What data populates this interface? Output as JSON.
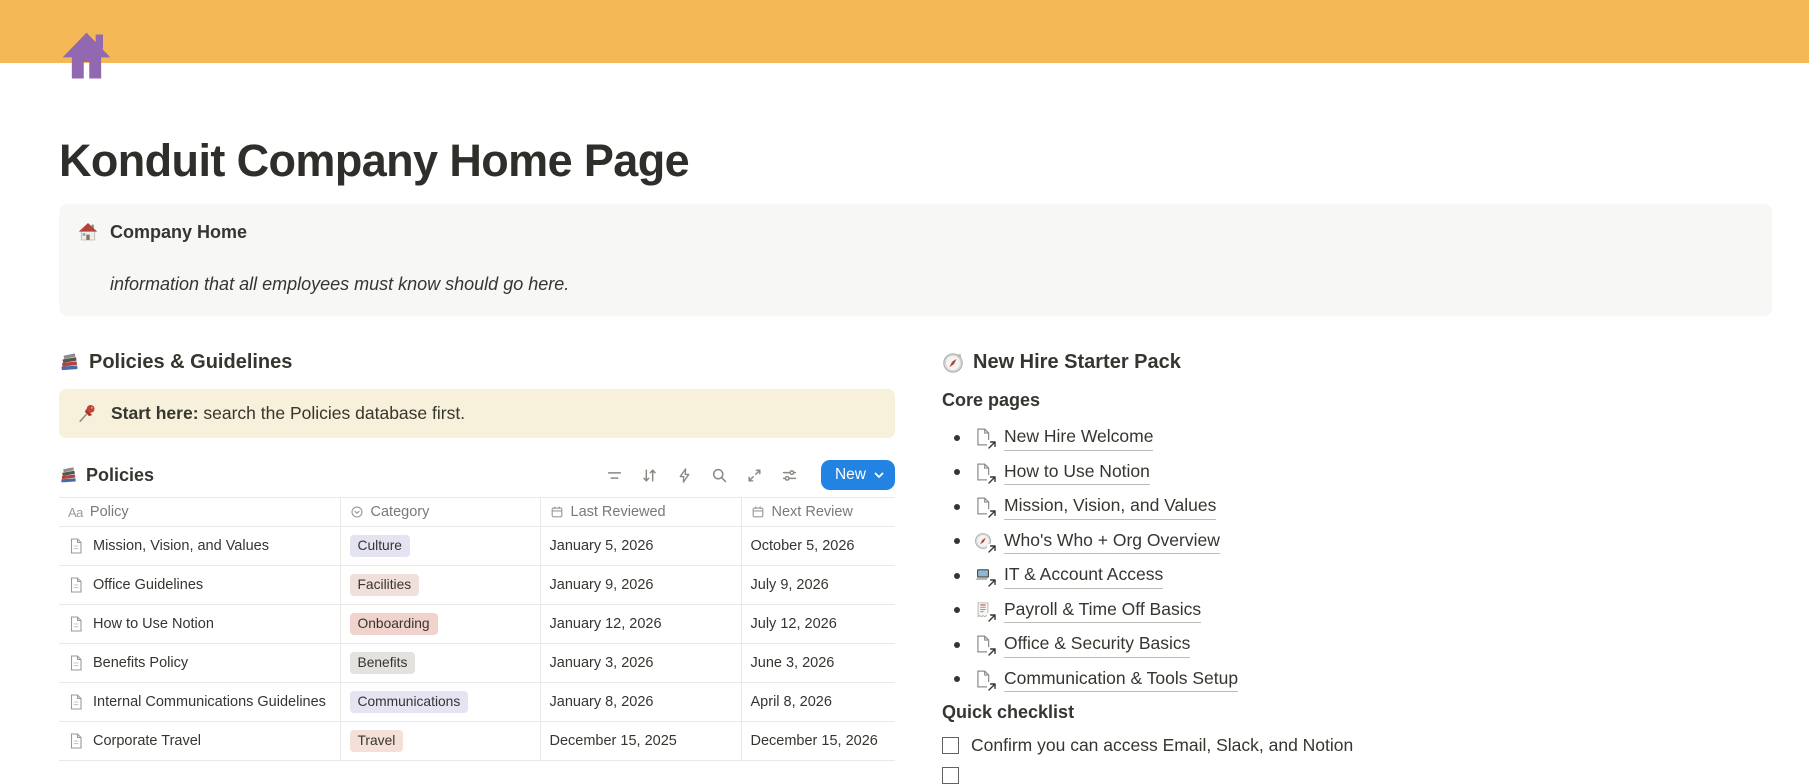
{
  "page": {
    "title": "Konduit Company Home Page"
  },
  "colors": {
    "cover": "#F5B857",
    "page_icon_purple": "#9268B1",
    "accent_blue": "#2383E2",
    "gray_callout_bg": "#F7F7F5",
    "yellow_callout_bg": "#F7F0DB"
  },
  "callout": {
    "icon": "house-icon",
    "title": "Company Home",
    "note": "information that all employees must know should go here."
  },
  "left": {
    "heading": "Policies & Guidelines",
    "heading_icon": "books-icon",
    "tip_icon": "pushpin-icon",
    "tip_bold": "Start here:",
    "tip_rest": " search the Policies database first.",
    "database": {
      "icon": "books-icon",
      "title": "Policies",
      "toolbar_icons": [
        "filter-icon",
        "sort-icon",
        "automation-icon",
        "search-icon",
        "expand-icon",
        "view-options-icon"
      ],
      "new_button": "New",
      "columns": [
        {
          "label": "Policy",
          "icon": "text-property-icon"
        },
        {
          "label": "Category",
          "icon": "select-property-icon"
        },
        {
          "label": "Last Reviewed",
          "icon": "date-property-icon"
        },
        {
          "label": "Next Review",
          "icon": "date-property-icon"
        }
      ],
      "rows": [
        {
          "policy": "Mission, Vision, and Values",
          "category": "Culture",
          "badge_style": "background:#E4E3F1",
          "last_reviewed": "January 5, 2026",
          "next_review": "October 5, 2026"
        },
        {
          "policy": "Office Guidelines",
          "category": "Facilities",
          "badge_style": "background:#F1DFDB",
          "last_reviewed": "January 9, 2026",
          "next_review": "July 9, 2026"
        },
        {
          "policy": "How to Use Notion",
          "category": "Onboarding",
          "badge_style": "background:#EFD3CC",
          "last_reviewed": "January 12, 2026",
          "next_review": "July 12, 2026"
        },
        {
          "policy": "Benefits Policy",
          "category": "Benefits",
          "badge_style": "background:#E3E2DE",
          "last_reviewed": "January 3, 2026",
          "next_review": "June 3, 2026"
        },
        {
          "policy": "Internal Communications Guidelines",
          "category": "Communications",
          "badge_style": "background:#E6E3F3",
          "last_reviewed": "January 8, 2026",
          "next_review": "April 8, 2026"
        },
        {
          "policy": "Corporate Travel",
          "category": "Travel",
          "badge_style": "background:#F5E0D7",
          "last_reviewed": "December 15, 2025",
          "next_review": "December 15, 2026"
        }
      ]
    }
  },
  "right": {
    "heading": "New Hire Starter Pack",
    "heading_icon": "compass-icon",
    "core_pages_label": "Core pages",
    "links": [
      {
        "label": "New Hire Welcome",
        "icon": "page-link-icon"
      },
      {
        "label": "How to Use Notion",
        "icon": "page-link-icon"
      },
      {
        "label": "Mission, Vision, and Values",
        "icon": "page-link-icon"
      },
      {
        "label": "Who's Who + Org Overview",
        "icon": "compass-link-icon"
      },
      {
        "label": "IT & Account Access",
        "icon": "laptop-link-icon"
      },
      {
        "label": "Payroll & Time Off Basics",
        "icon": "receipt-link-icon"
      },
      {
        "label": "Office & Security Basics",
        "icon": "page-link-icon"
      },
      {
        "label": "Communication & Tools Setup",
        "icon": "page-link-icon"
      }
    ],
    "checklist_label": "Quick checklist",
    "checklist": [
      {
        "label": "Confirm you can access Email, Slack, and Notion",
        "checked": false
      },
      {
        "label": "",
        "checked": false
      }
    ]
  }
}
